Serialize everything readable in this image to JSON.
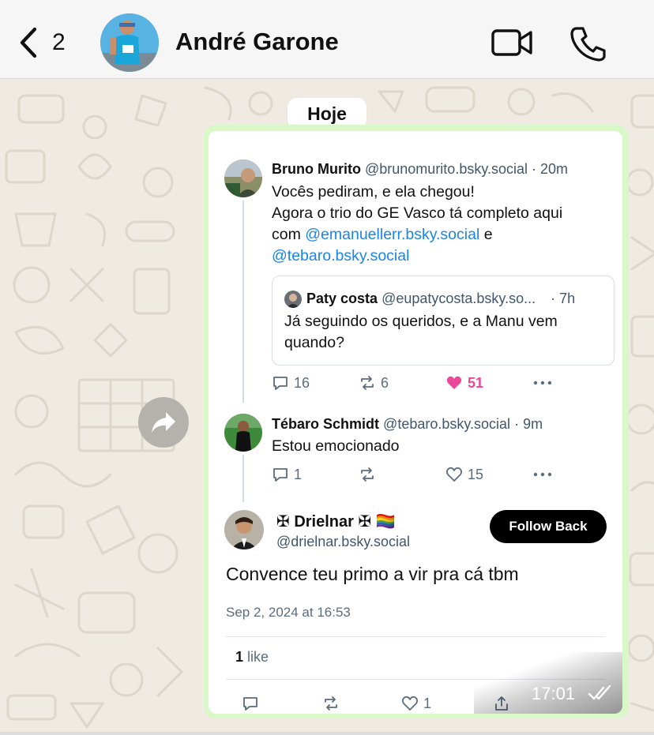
{
  "header": {
    "back_count": "2",
    "contact_name": "André Garone",
    "icons": [
      "chevron-left-icon",
      "video-call-icon",
      "phone-icon"
    ]
  },
  "chat": {
    "date_label": "Hoje",
    "message_time": "17:01",
    "read_status": "double-check-icon"
  },
  "post": {
    "top_fragment": "· ··",
    "first": {
      "name": "Bruno Murito",
      "handle": "@brunomurito.bsky.social",
      "time": "· 20m",
      "lines": [
        "Vocês pediram, e ela chegou!",
        "Agora o trio do GE Vasco tá completo aqui"
      ],
      "with_text": "com ",
      "mention1": "@emanuellerr.bsky.social",
      "and_text": " e",
      "mention2": "@tebaro.bsky.social",
      "quote": {
        "name": "Paty costa",
        "handle": "@eupatycosta.bsky.so...",
        "time": "· 7h",
        "lines": [
          "Já seguindo os queridos, e a Manu vem",
          "quando?"
        ]
      },
      "replies": "16",
      "reposts": "6",
      "likes": "51"
    },
    "second": {
      "name": "Tébaro Schmidt",
      "handle": "@tebaro.bsky.social",
      "time": "· 9m",
      "text": "Estou emocionado",
      "replies": "1",
      "likes": "15"
    },
    "main": {
      "display_name": "✠ Drielnar ✠ 🏳️‍🌈",
      "handle": "@drielnar.bsky.social",
      "follow_label": "Follow Back",
      "text": "Convence teu primo a vir pra cá tbm",
      "timestamp": "Sep 2, 2024 at 16:53",
      "like_count": "1",
      "like_word": " like",
      "likes": "1"
    }
  },
  "colors": {
    "bubble": "#d8f8c7",
    "mention": "#1a84e8",
    "heart": "#ec4899",
    "wallpaper": "#efeae2"
  }
}
